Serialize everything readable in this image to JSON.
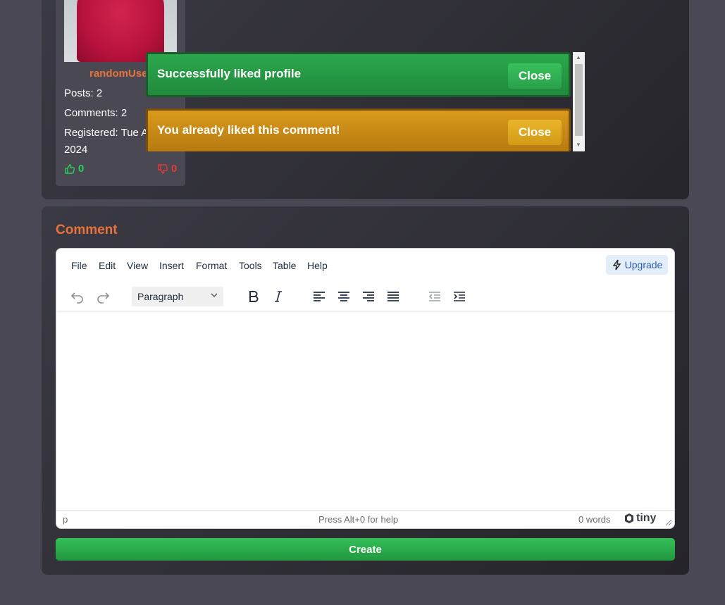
{
  "profile": {
    "username": "randomUse",
    "posts": "Posts: 2",
    "comments": "Comments: 2",
    "registered_line1": "Registered: Tue A",
    "registered_line2": "2024",
    "likes": "0",
    "dislikes": "0"
  },
  "toasts": [
    {
      "message": "Successfully liked profile",
      "close_label": "Close",
      "color": "#2ca84c"
    },
    {
      "message": "You already liked this comment!",
      "close_label": "Close",
      "color": "#d99a1c"
    }
  ],
  "comment_section": {
    "title": "Comment",
    "create_label": "Create"
  },
  "editor": {
    "menu": [
      "File",
      "Edit",
      "View",
      "Insert",
      "Format",
      "Tools",
      "Table",
      "Help"
    ],
    "upgrade_label": "Upgrade",
    "block_format": "Paragraph",
    "toolbar_icons": [
      "undo-icon",
      "redo-icon",
      "bold-icon",
      "italic-icon",
      "align-left-icon",
      "align-center-icon",
      "align-right-icon",
      "justify-icon",
      "outdent-icon",
      "indent-icon"
    ],
    "status_path": "p",
    "help_hint": "Press Alt+0 for help",
    "word_count": "0 words",
    "brand": "tiny"
  },
  "colors": {
    "accent_orange": "#e8733a",
    "success_green": "#2ca84c",
    "warning_amber": "#d99a1c"
  }
}
